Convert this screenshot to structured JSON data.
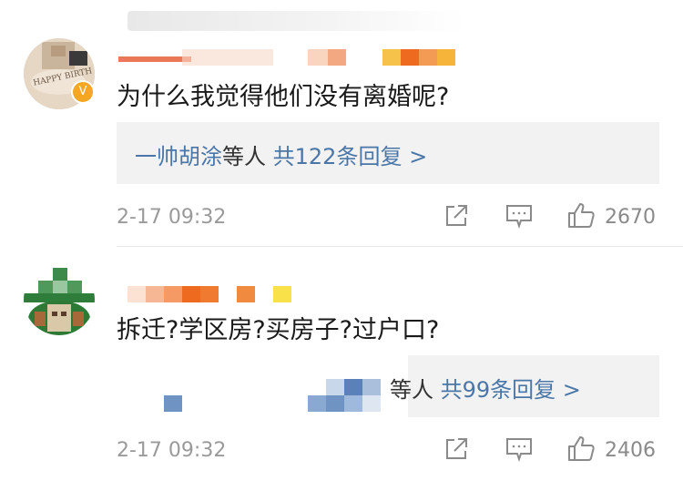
{
  "comments": [
    {
      "text": "为什么我觉得他们没有离婚呢?",
      "reply_names": "一帅胡涂",
      "reply_mid": "等人",
      "reply_count": "共122条回复 >",
      "time": "2-17 09:32",
      "likes": "2670",
      "badge": "V",
      "avatar_text": "HAPPY BIRTH"
    },
    {
      "text": "拆迁?学区房?买房子?过户口?",
      "reply_mid": "等人",
      "reply_count": "共99条回复 >",
      "time": "2-17 09:32",
      "likes": "2406"
    }
  ],
  "icons": [
    "share-icon",
    "comment-icon",
    "like-icon"
  ],
  "colors": {
    "link": "#4a76a8",
    "badge": "#f5a623",
    "meta": "#9a9a9a"
  }
}
